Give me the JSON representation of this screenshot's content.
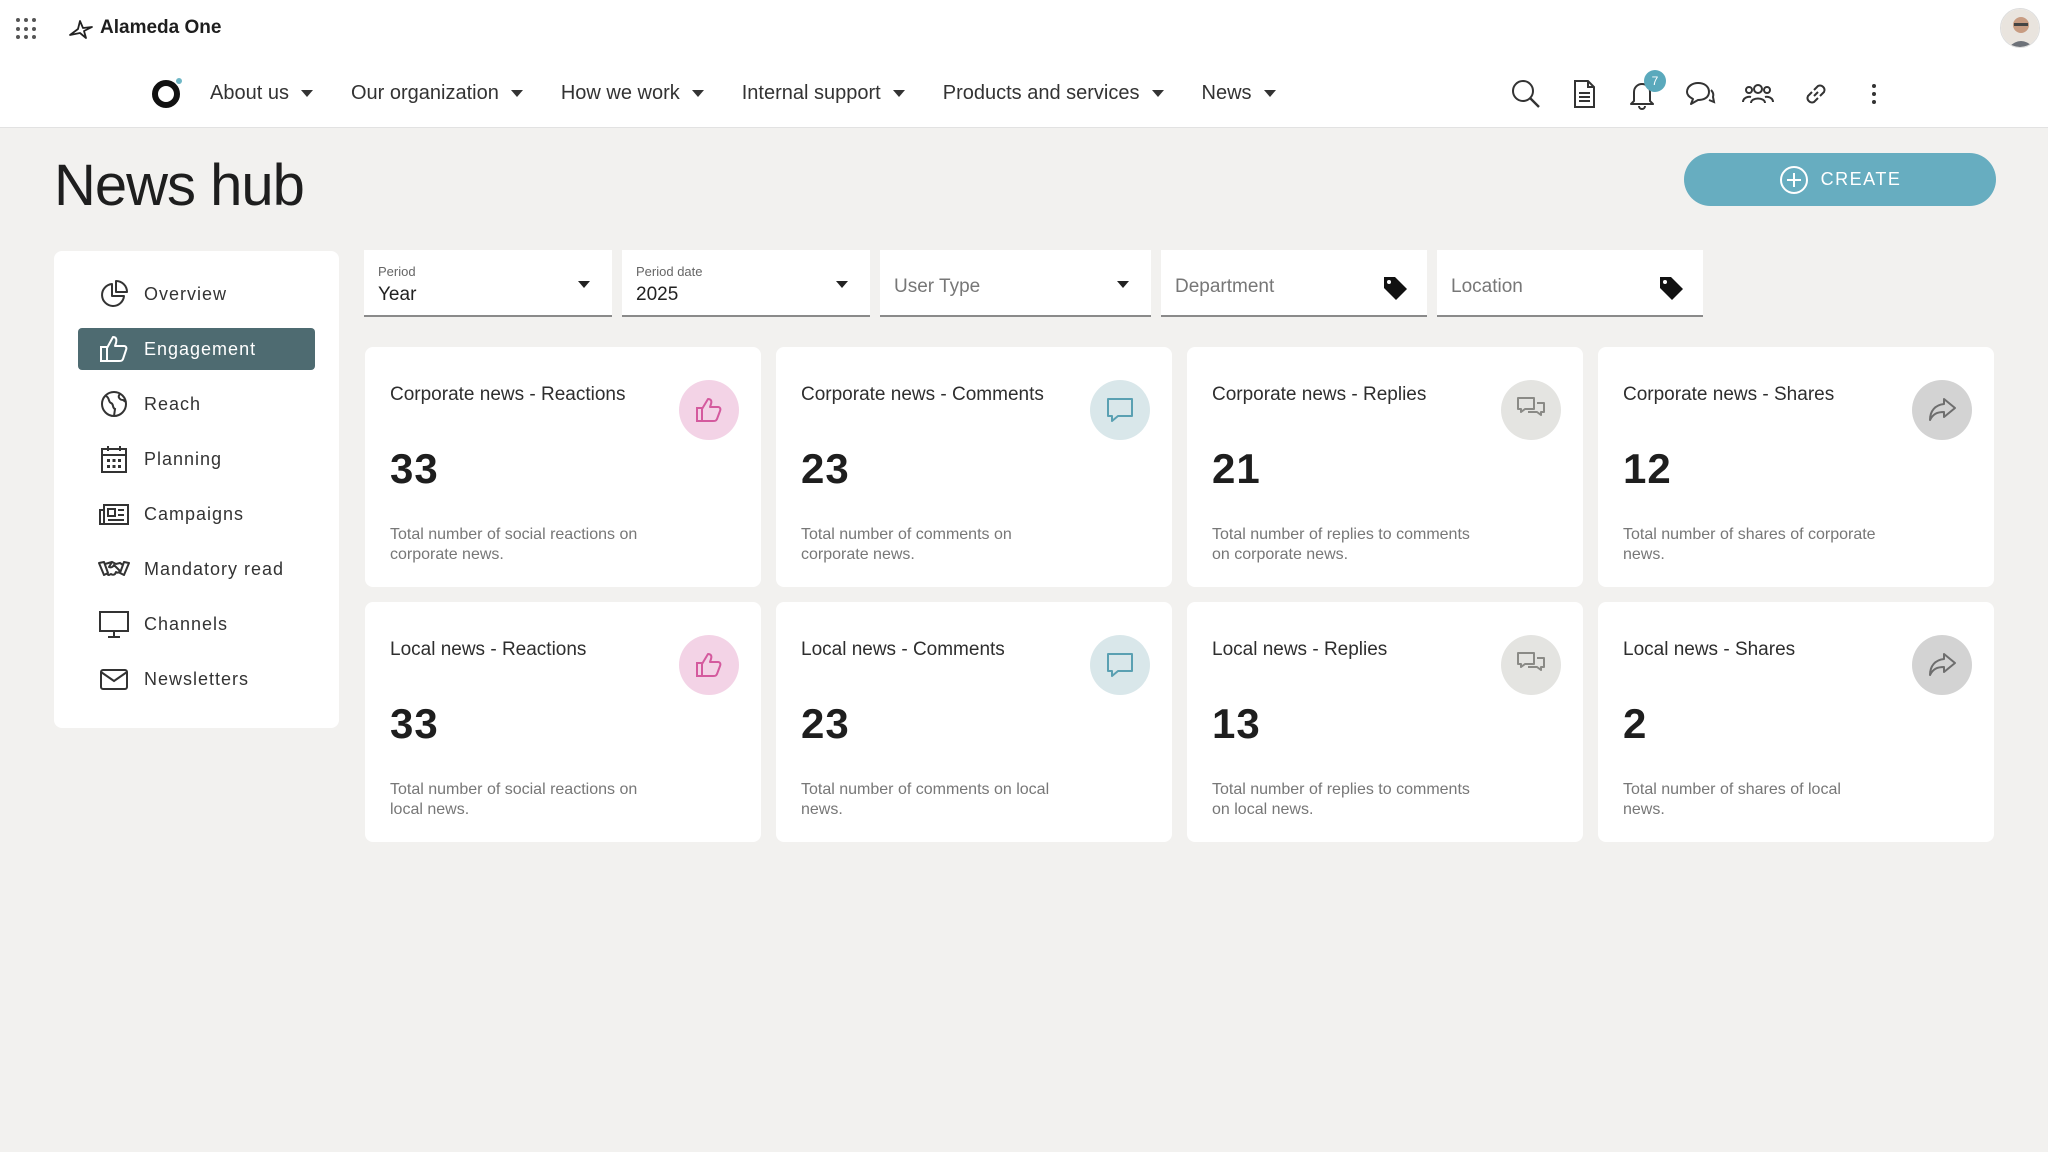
{
  "app": {
    "brand_name": "Alameda One",
    "app_grid_icon": "apps-grid-icon",
    "avatar_icon": "user-avatar"
  },
  "nav": {
    "items": [
      {
        "label": "About us"
      },
      {
        "label": "Our organization"
      },
      {
        "label": "How we work"
      },
      {
        "label": "Internal support"
      },
      {
        "label": "Products and services"
      },
      {
        "label": "News"
      }
    ],
    "tools": [
      {
        "icon": "search-icon"
      },
      {
        "icon": "document-icon"
      },
      {
        "icon": "bell-icon",
        "badge": "7"
      },
      {
        "icon": "chat-icon"
      },
      {
        "icon": "people-icon"
      },
      {
        "icon": "link-icon"
      },
      {
        "icon": "more-vertical-icon"
      }
    ]
  },
  "page": {
    "title": "News hub",
    "create_label": "CREATE"
  },
  "sidebar": {
    "items": [
      {
        "label": "Overview",
        "icon": "pie-chart-icon",
        "active": false
      },
      {
        "label": "Engagement",
        "icon": "thumbs-up-icon",
        "active": true
      },
      {
        "label": "Reach",
        "icon": "globe-icon",
        "active": false
      },
      {
        "label": "Planning",
        "icon": "calendar-icon",
        "active": false
      },
      {
        "label": "Campaigns",
        "icon": "newspaper-icon",
        "active": false
      },
      {
        "label": "Mandatory read",
        "icon": "handshake-icon",
        "active": false
      },
      {
        "label": "Channels",
        "icon": "monitor-icon",
        "active": false
      },
      {
        "label": "Newsletters",
        "icon": "envelope-icon",
        "active": false
      }
    ]
  },
  "filters": {
    "period": {
      "label": "Period",
      "value": "Year"
    },
    "period_date": {
      "label": "Period date",
      "value": "2025"
    },
    "user_type": {
      "placeholder": "User Type"
    },
    "department": {
      "placeholder": "Department"
    },
    "location": {
      "placeholder": "Location"
    }
  },
  "cards": [
    {
      "title": "Corporate news - Reactions",
      "value": "33",
      "description": "Total number of social reactions on corporate news.",
      "icon": "thumbs-up-icon"
    },
    {
      "title": "Corporate news - Comments",
      "value": "23",
      "description": "Total number of comments on corporate news.",
      "icon": "comment-icon"
    },
    {
      "title": "Corporate news - Replies",
      "value": "21",
      "description": "Total number of replies to comments on corporate news.",
      "icon": "replies-icon"
    },
    {
      "title": "Corporate news - Shares",
      "value": "12",
      "description": "Total number of shares of corporate news.",
      "icon": "share-icon"
    },
    {
      "title": "Local news - Reactions",
      "value": "33",
      "description": "Total number of social reactions on local news.",
      "icon": "thumbs-up-icon"
    },
    {
      "title": "Local news - Comments",
      "value": "23",
      "description": "Total number of comments on local news.",
      "icon": "comment-icon"
    },
    {
      "title": "Local news - Replies",
      "value": "13",
      "description": "Total number of replies to comments on local news.",
      "icon": "replies-icon"
    },
    {
      "title": "Local news - Shares",
      "value": "2",
      "description": "Total number of shares of local news.",
      "icon": "share-icon"
    }
  ],
  "colors": {
    "accent": "#67adc0",
    "sidebar_active": "#4e6b71",
    "badge": "#5aa9bc",
    "reactions_bg": "#f3d3e6",
    "reactions_fg": "#d45a9e",
    "comments_bg": "#d9e7ea",
    "comments_fg": "#5aa0b2",
    "replies_bg": "#e4e4e1",
    "replies_fg": "#8a8a86",
    "shares_bg": "#d3d3d3",
    "shares_fg": "#6e6e6e"
  }
}
